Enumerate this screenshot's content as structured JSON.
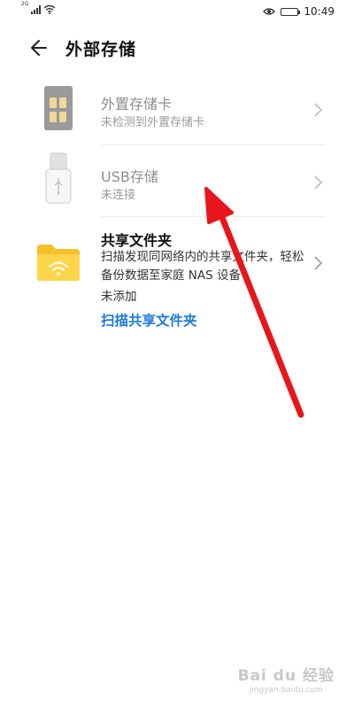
{
  "status_bar": {
    "network": "2G",
    "time": "10:49",
    "icons": [
      "signal-icon",
      "wifi-icon",
      "eye-comfort-icon",
      "battery-icon"
    ]
  },
  "header": {
    "title": "外部存储",
    "back_icon": "arrow-left-icon"
  },
  "storage_items": [
    {
      "title": "外置存储卡",
      "subtitle": "未检测到外置存储卡",
      "icon": "sd-card-icon",
      "enabled": false
    },
    {
      "title": "USB存储",
      "subtitle": "未连接",
      "icon": "usb-drive-icon",
      "enabled": false
    }
  ],
  "shared_folder": {
    "title": "共享文件夹",
    "description": "扫描发现同网络内的共享文件夹，轻松备份数据至家庭 NAS 设备",
    "status": "未添加",
    "action_label": "扫描共享文件夹",
    "icon": "wifi-folder-icon"
  },
  "colors": {
    "link": "#1c7bd6",
    "folder": "#ffd54a",
    "annotation_arrow": "#e8161c"
  },
  "watermark": {
    "main": "Bai du 经验",
    "sub": "jingyan.baidu.com"
  }
}
